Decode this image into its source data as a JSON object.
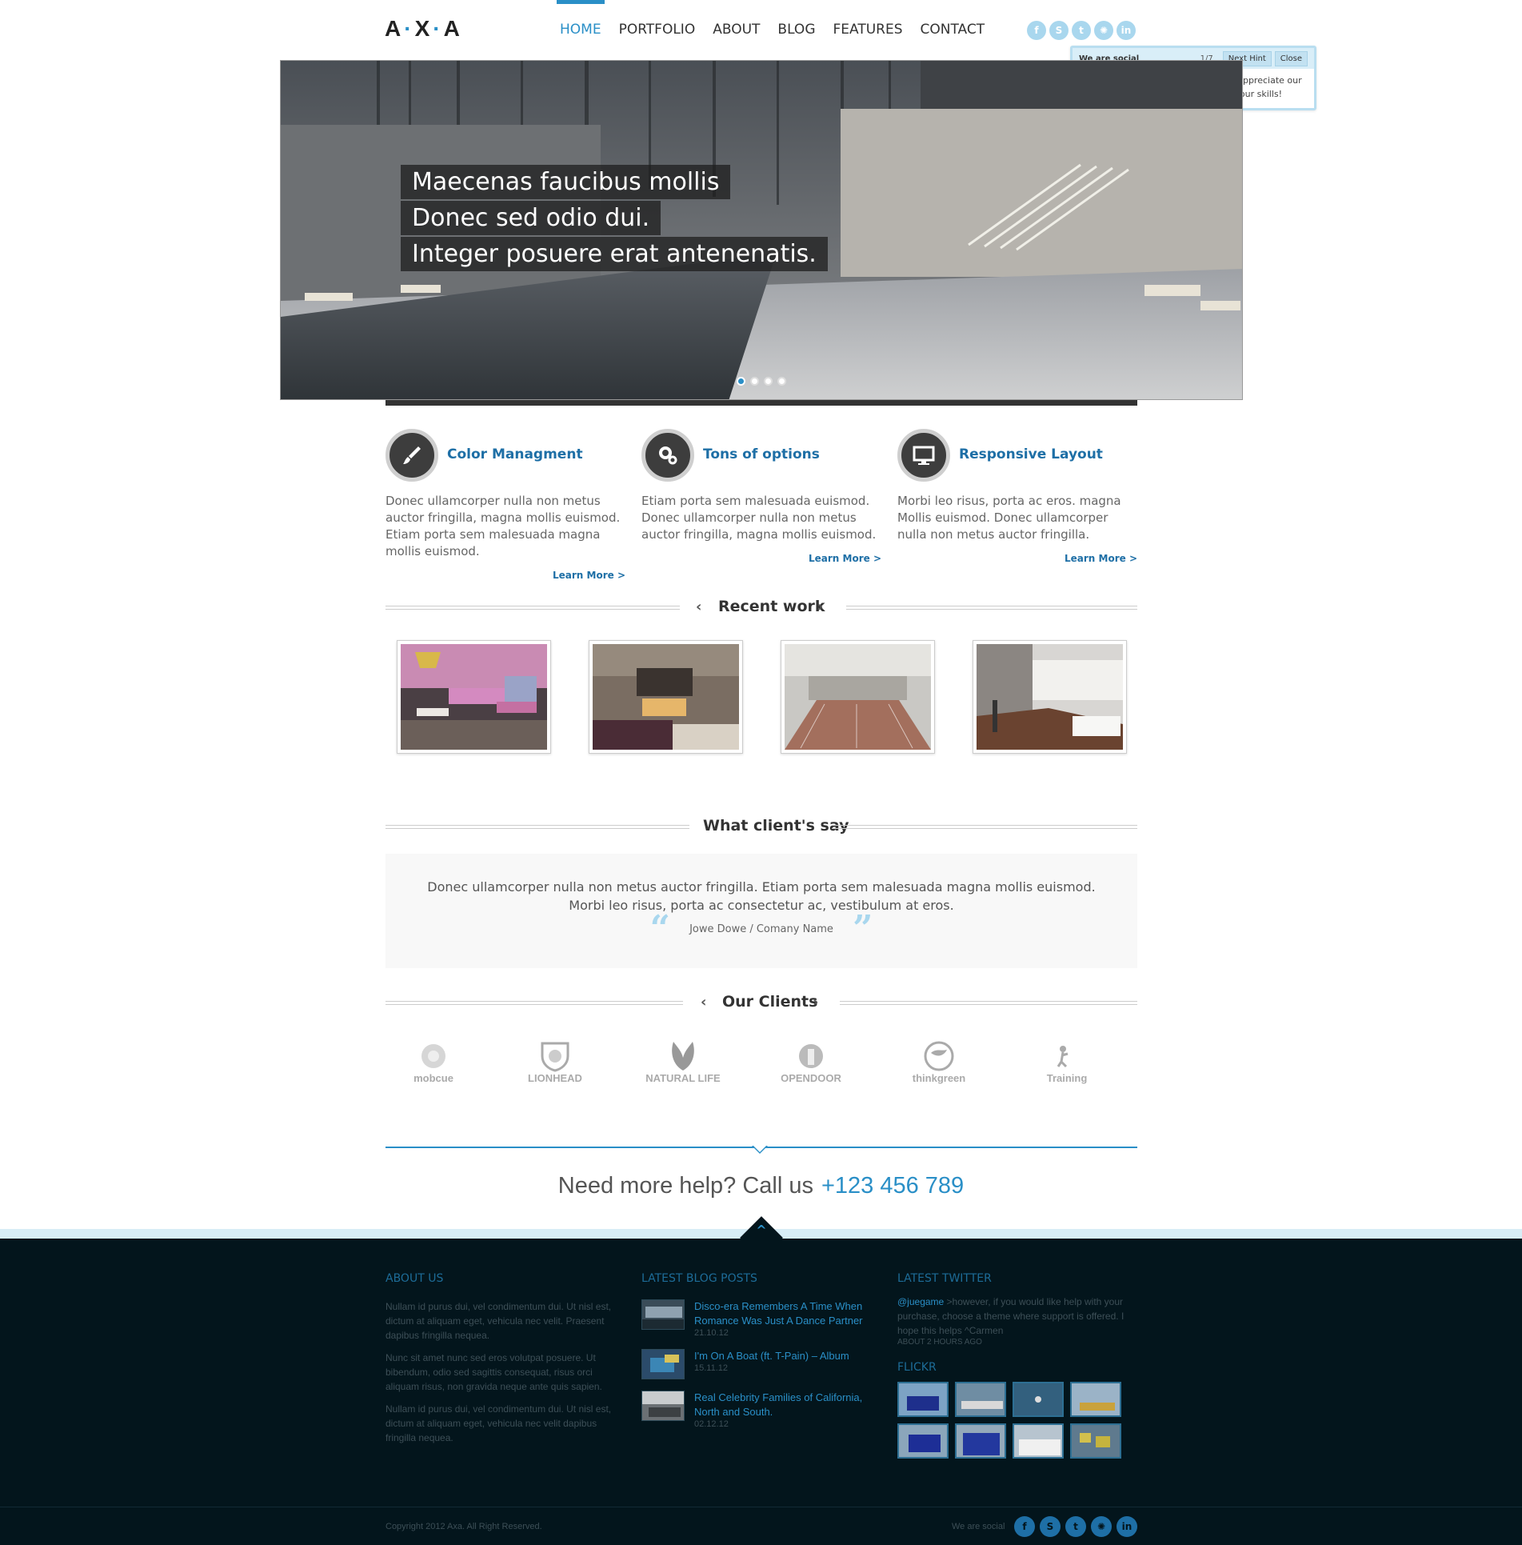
{
  "header": {
    "logo": {
      "a1": "A",
      "x": "X",
      "a2": "A",
      "dot": "·"
    },
    "nav": [
      "HOME",
      "PORTFOLIO",
      "ABOUT",
      "BLOG",
      "FEATURES",
      "CONTACT"
    ],
    "active_nav": "HOME",
    "social": [
      {
        "icon": "facebook-icon",
        "glyph": "f"
      },
      {
        "icon": "skype-icon",
        "glyph": "S"
      },
      {
        "icon": "twitter-icon",
        "glyph": "t"
      },
      {
        "icon": "dribbble-icon",
        "glyph": "✺"
      },
      {
        "icon": "linkedin-icon",
        "glyph": "in"
      }
    ]
  },
  "hint": {
    "title": "We are social",
    "count": "1/7",
    "next_label": "Next Hint",
    "close_label": "Close",
    "body": "Find us on various social networks. Appreciate our activity, share our content and rate our skills!"
  },
  "slider": {
    "captions": [
      "Maecenas faucibus mollis",
      "Donec sed odio dui.",
      "Integer posuere erat antenenatis."
    ],
    "slide_count": 4,
    "active_slide": 1
  },
  "features": [
    {
      "icon": "paintbrush-icon",
      "title": "Color Managment",
      "text": "Donec ullamcorper nulla non metus auctor fringilla, magna mollis euismod. Etiam porta sem malesuada magna mollis euismod.",
      "more": "Learn More >"
    },
    {
      "icon": "gears-icon",
      "title": "Tons of options",
      "text": "Etiam porta sem malesuada euismod. Donec ullamcorper nulla non metus auctor fringilla, magna mollis euismod.",
      "more": "Learn More >"
    },
    {
      "icon": "monitor-icon",
      "title": "Responsive Layout",
      "text": "Morbi leo risus, porta ac eros. magna Mollis euismod. Donec ullamcorper nulla non metus auctor fringilla.",
      "more": "Learn More >"
    }
  ],
  "recent_work": {
    "title": "Recent work",
    "prev": "‹",
    "next": "›",
    "items": [
      "pink lounge interior",
      "bedroom with fireplace",
      "indoor pool hall",
      "loft with staircase"
    ]
  },
  "testimonial": {
    "title": "What client's say",
    "line1": "Donec ullamcorper nulla non metus auctor fringilla. Etiam porta sem malesuada magna mollis euismod.",
    "line2": "Morbi leo risus, porta ac consectetur ac, vestibulum at eros.",
    "author": "Jowe Dowe / Comany Name",
    "open_quote": "“",
    "close_quote": "”"
  },
  "clients": {
    "title": "Our Clients",
    "prev": "‹",
    "next": "›",
    "logos": [
      "mobcue",
      "LIONHEAD",
      "NATURAL LIFE",
      "OPENDOOR",
      "thinkgreen",
      "Training"
    ]
  },
  "help": {
    "text": "Need more help? Call us",
    "phone": "+123 456 789"
  },
  "footer": {
    "about": {
      "title": "ABOUT US",
      "paragraphs": [
        "Nullam id purus dui, vel condimentum dui. Ut nisl est, dictum at aliquam eget, vehicula nec velit. Praesent dapibus fringilla nequea.",
        "Nunc sit amet nunc sed eros volutpat posuere. Ut bibendum, odio sed sagittis consequat, risus orci aliquam risus, non gravida neque ante quis sapien.",
        "Nullam id purus dui, vel condimentum dui. Ut nisl est, dictum at aliquam eget, vehicula nec velit dapibus fringilla nequea."
      ]
    },
    "blog": {
      "title": "LATEST BLOG POSTS",
      "posts": [
        {
          "title": "Disco-era Remembers A Time When Romance Was Just A Dance Partner",
          "date": "21.10.12"
        },
        {
          "title": "I'm On A Boat (ft. T-Pain) – Album",
          "date": "15.11.12"
        },
        {
          "title": "Real Celebrity Families of California, North and South.",
          "date": "02.12.12"
        }
      ]
    },
    "twitter": {
      "title": "LATEST TWITTER",
      "handle": "@juegame",
      "text": " >however, if you would like help with your purchase, choose a theme where support is offered. I hope this helps ^Carmen",
      "time": "ABOUT 2 HOURS AGO"
    },
    "flickr": {
      "title": "FLICKR",
      "count": 8
    },
    "copyright": "Copyright 2012 Axa. All Right Reserved.",
    "we_are_social": "We are social",
    "up_glyph": "^"
  },
  "colors": {
    "accent": "#2a8fc7",
    "feature_title": "#1e6fa6",
    "footer_bg": "#03151c",
    "dark_text": "#333333"
  }
}
